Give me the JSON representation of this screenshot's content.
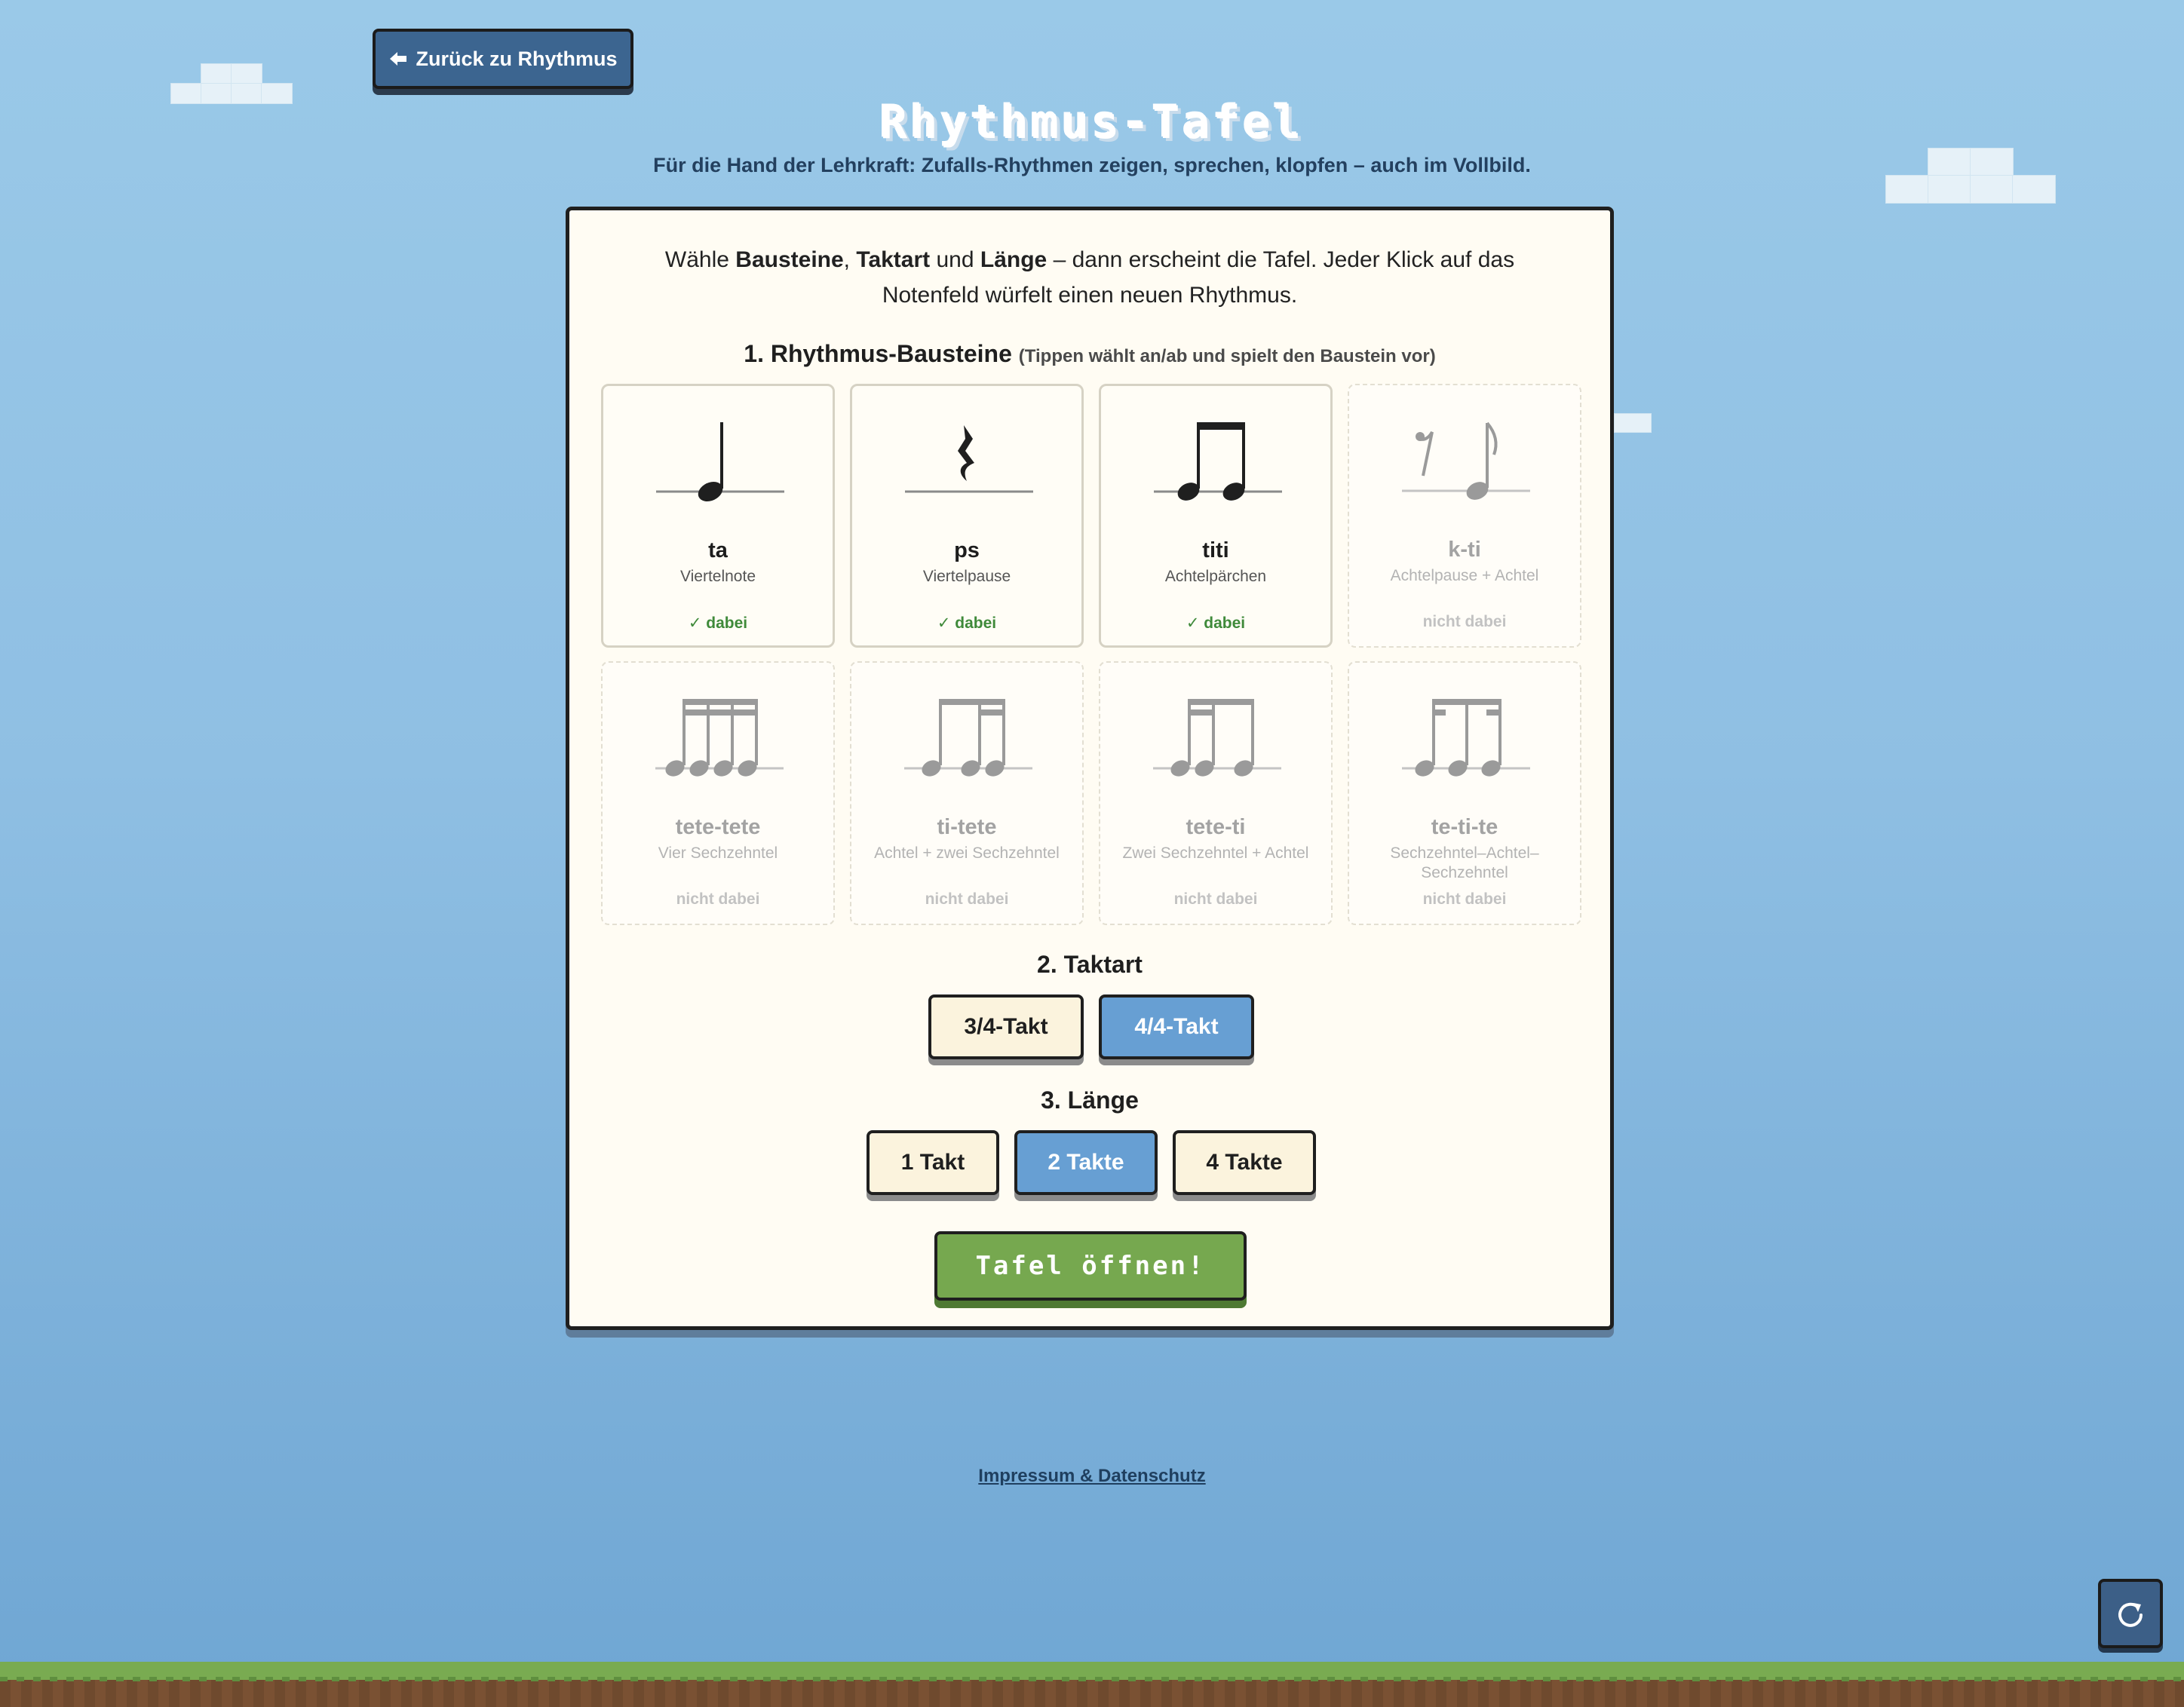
{
  "nav": {
    "back_label": "Zurück zu Rhythmus"
  },
  "header": {
    "title": "Rhythmus-Tafel",
    "subtitle": "Für die Hand der Lehrkraft: Zufalls-Rhythmen zeigen, sprechen, klopfen – auch im Vollbild."
  },
  "intro": {
    "pre": "Wähle ",
    "b1": "Bausteine",
    "sep1": ", ",
    "b2": "Taktart",
    "mid": " und ",
    "b3": "Länge",
    "rest1": " – dann erscheint die Tafel. Jeder Klick auf das",
    "line2": "Notenfeld würfelt einen neuen Rhythmus."
  },
  "section1": {
    "title": "1. Rhythmus-Bausteine",
    "hint": "(Tippen wählt an/ab und spielt den Baustein vor)",
    "blocks": [
      {
        "syllable": "ta",
        "description": "Viertelnote",
        "status": "dabei",
        "selected": true,
        "icon": "quarter-note"
      },
      {
        "syllable": "ps",
        "description": "Viertelpause",
        "status": "dabei",
        "selected": true,
        "icon": "quarter-rest"
      },
      {
        "syllable": "titi",
        "description": "Achtelpärchen",
        "status": "dabei",
        "selected": true,
        "icon": "eighth-pair"
      },
      {
        "syllable": "k-ti",
        "description": "Achtelpause + Achtel",
        "status": "nicht dabei",
        "selected": false,
        "icon": "eighth-rest-eighth"
      },
      {
        "syllable": "tete-tete",
        "description": "Vier Sechzehntel",
        "status": "nicht dabei",
        "selected": false,
        "icon": "four-sixteenths"
      },
      {
        "syllable": "ti-tete",
        "description": "Achtel + zwei Sechzehntel",
        "status": "nicht dabei",
        "selected": false,
        "icon": "eighth-two-sixteenths"
      },
      {
        "syllable": "tete-ti",
        "description": "Zwei Sechzehntel + Achtel",
        "status": "nicht dabei",
        "selected": false,
        "icon": "two-sixteenths-eighth"
      },
      {
        "syllable": "te-ti-te",
        "description": "Sechzehntel–Achtel–Sechzehntel",
        "status": "nicht dabei",
        "selected": false,
        "icon": "sixteenth-eighth-sixteenth"
      }
    ],
    "status_check_icon": "check-icon"
  },
  "section2": {
    "title": "2. Taktart",
    "options": [
      {
        "label": "3/4-Takt",
        "selected": false
      },
      {
        "label": "4/4-Takt",
        "selected": true
      }
    ]
  },
  "section3": {
    "title": "3. Länge",
    "options": [
      {
        "label": "1 Takt",
        "selected": false
      },
      {
        "label": "2 Takte",
        "selected": true
      },
      {
        "label": "4 Takte",
        "selected": false
      }
    ]
  },
  "action": {
    "open_label": "Tafel öffnen!"
  },
  "footer": {
    "link_label": "Impressum & Datenschutz"
  },
  "colors": {
    "sky": "#9ac9e8",
    "selected_blue": "#679fd3",
    "nav_blue": "#3c6590",
    "green": "#76a84f",
    "status_green": "#3f8a3a",
    "panel": "#fffcf3"
  }
}
